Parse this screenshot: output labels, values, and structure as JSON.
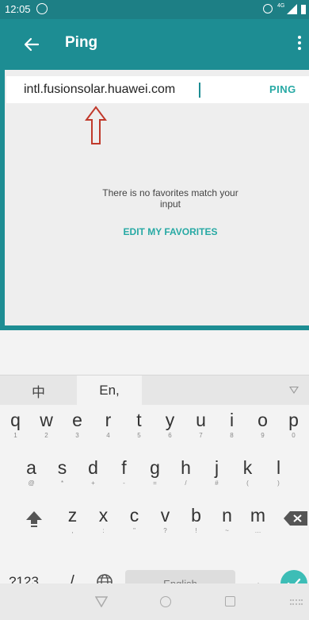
{
  "status_bar": {
    "time": "12:05",
    "network": "4G"
  },
  "app_bar": {
    "title": "Ping"
  },
  "search": {
    "value": "intl.fusionsolar.huawei.com",
    "button": "PING"
  },
  "favorites": {
    "empty_message": "There is no favorites match your input",
    "edit_link": "EDIT MY FAVORITES"
  },
  "keyboard": {
    "toolbar": {
      "lang_zh": "中",
      "lang_en": "En,"
    },
    "row1": [
      {
        "k": "q",
        "s": "1"
      },
      {
        "k": "w",
        "s": "2"
      },
      {
        "k": "e",
        "s": "3"
      },
      {
        "k": "r",
        "s": "4"
      },
      {
        "k": "t",
        "s": "5"
      },
      {
        "k": "y",
        "s": "6"
      },
      {
        "k": "u",
        "s": "7"
      },
      {
        "k": "i",
        "s": "8"
      },
      {
        "k": "o",
        "s": "9"
      },
      {
        "k": "p",
        "s": "0"
      }
    ],
    "row2": [
      {
        "k": "a",
        "s": "@"
      },
      {
        "k": "s",
        "s": "*"
      },
      {
        "k": "d",
        "s": "+"
      },
      {
        "k": "f",
        "s": "-"
      },
      {
        "k": "g",
        "s": "="
      },
      {
        "k": "h",
        "s": "/"
      },
      {
        "k": "j",
        "s": "#"
      },
      {
        "k": "k",
        "s": "("
      },
      {
        "k": "l",
        "s": ")"
      }
    ],
    "row3": [
      {
        "k": "z",
        "s": ","
      },
      {
        "k": "x",
        "s": ":"
      },
      {
        "k": "c",
        "s": "\""
      },
      {
        "k": "v",
        "s": "?"
      },
      {
        "k": "b",
        "s": "!"
      },
      {
        "k": "n",
        "s": "~"
      },
      {
        "k": "m",
        "s": "…"
      }
    ],
    "bottom": {
      "symbols": "?123",
      "slash": "/",
      "space": "English",
      "dot": "."
    }
  },
  "colors": {
    "teal_dark": "#1d7f85",
    "teal": "#1d8d93",
    "accent": "#27a9a4",
    "arrow": "#c0392b"
  }
}
